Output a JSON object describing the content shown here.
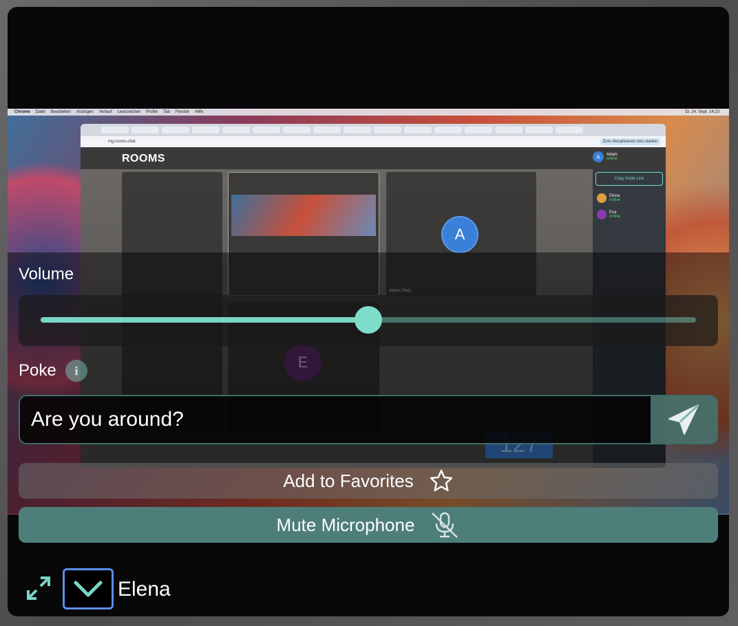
{
  "shared_screen": {
    "mac_menu": [
      "Chrome",
      "Datei",
      "Bearbeiten",
      "Anzeigen",
      "Verlauf",
      "Lesezeichen",
      "Profile",
      "Tab",
      "Fenster",
      "Hilfe"
    ],
    "clock": "Di. 24. Sept. 14:23",
    "url": "mg.rooms.chat",
    "update_button": "Zum Aktualisieren neu starten",
    "app_logo": "ROOMS",
    "current_user": {
      "name": "Adam",
      "status": "online",
      "initial": "A"
    },
    "copy_invite_label": "Copy Invite Link",
    "participants": [
      {
        "name": "Elena",
        "status": "online",
        "initial": "E",
        "color": "#e0a040"
      },
      {
        "name": "Eva",
        "status": "online",
        "initial": "E",
        "color": "#8a3ab0"
      }
    ],
    "tile_avatar_a": "A",
    "tile_avatar_e": "E",
    "tile_caption_adam": "Adam (You)",
    "badge_number": "127"
  },
  "volume": {
    "label": "Volume",
    "level": 0.5
  },
  "poke": {
    "label": "Poke",
    "info_glyph": "i",
    "value": "Are you around?",
    "placeholder": ""
  },
  "buttons": {
    "favorites_label": "Add to Favorites",
    "mute_label": "Mute Microphone"
  },
  "footer": {
    "user_name": "Elena"
  },
  "colors": {
    "accent": "#7ad6c6",
    "mute_bg": "#4d7e7a",
    "focus_ring": "#5b8ef0"
  }
}
